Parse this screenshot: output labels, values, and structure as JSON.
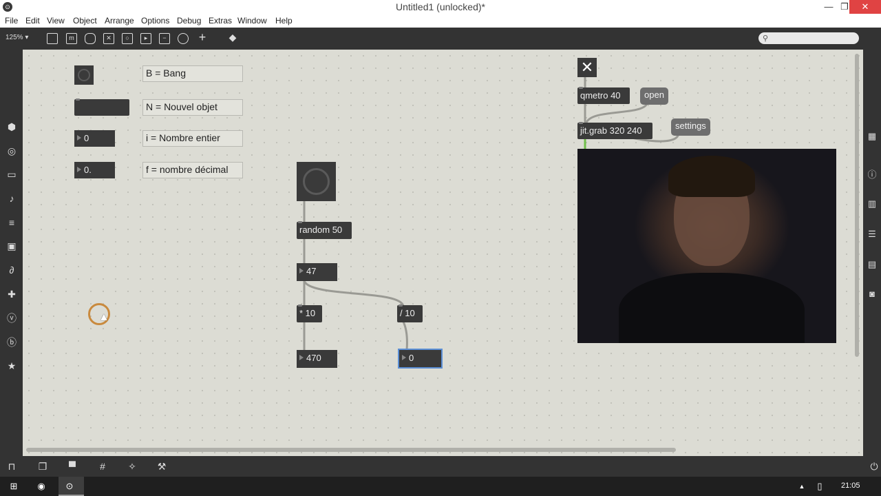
{
  "window": {
    "title": "Untitled1 (unlocked)*",
    "app_icon": "max-logo-icon"
  },
  "menu": [
    "File",
    "Edit",
    "View",
    "Object",
    "Arrange",
    "Options",
    "Debug",
    "Extras",
    "Window",
    "Help"
  ],
  "toolbar": {
    "zoom": "125% ▾",
    "search_placeholder": ""
  },
  "legend": [
    {
      "key": "bang",
      "label": "B = Bang"
    },
    {
      "key": "object",
      "label": "N = Nouvel objet"
    },
    {
      "key": "int",
      "value": "0",
      "label": "i = Nombre entier"
    },
    {
      "key": "float",
      "value": "0.",
      "label": "f = nombre décimal"
    }
  ],
  "patch": {
    "random": "random 50",
    "num_random": "47",
    "mult": "* 10",
    "div": "/ 10",
    "num_mult": "470",
    "num_div": "0"
  },
  "video_patch": {
    "toggle": "✕",
    "qmetro": "qmetro 40",
    "open_msg": "open",
    "grab": "jit.grab 320 240",
    "settings_msg": "settings"
  },
  "taskbar": {
    "clock": "21:05"
  },
  "colors": {
    "canvas": "#dcdcd4",
    "object": "#3a3a3a",
    "message": "#6e6e6e",
    "cursor_ring": "#c98a3e"
  }
}
